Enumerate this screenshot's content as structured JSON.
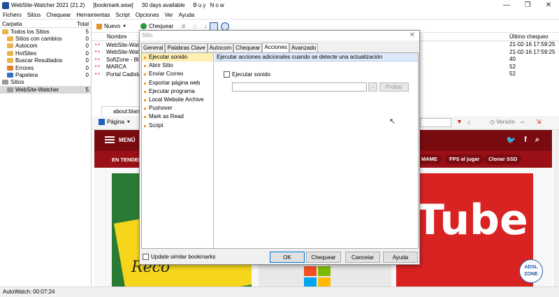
{
  "window": {
    "title": "WebSite-Watcher 2021 (21.2)",
    "file": "[bookmark.wsw]",
    "trial": "30 days available",
    "buy": "Buy Now",
    "controls": [
      "—",
      "❐",
      "✕"
    ]
  },
  "menu": [
    "Fichero",
    "Sitios",
    "Chequear",
    "Herramientas",
    "Script",
    "Opciones",
    "Ver",
    "Ayuda"
  ],
  "folders": {
    "head_folder": "Carpeta",
    "head_total": "Total",
    "items": [
      {
        "label": "Todos los Sitios",
        "count": "5",
        "color": "#e8b64c"
      },
      {
        "label": "Sitios con cambios",
        "count": "0",
        "color": "#e8b64c"
      },
      {
        "label": "Autocom",
        "count": "0",
        "color": "#e8b64c"
      },
      {
        "label": "HotSites",
        "count": "0",
        "color": "#e8b64c"
      },
      {
        "label": "Buscar Resultados",
        "count": "0",
        "color": "#e8b64c"
      },
      {
        "label": "Errores",
        "count": "0",
        "color": "#d9822b"
      },
      {
        "label": "Papelera",
        "count": "0",
        "color": "#2f6fc4"
      },
      {
        "label": "Sitios",
        "count": "",
        "color": "#9a9a9a"
      },
      {
        "label": "WebSite-Watcher",
        "count": "5",
        "color": "#9a9a9a"
      }
    ]
  },
  "toolbar": {
    "new": "Nuevo",
    "check": "Chequear"
  },
  "list": {
    "col_name": "Nombre",
    "col_check": "Último chequeo",
    "rows": [
      "WebSite-Watch",
      "WebSite-Watch",
      "SoftZone - Bl",
      "MARCA",
      "Portal Cadista"
    ],
    "check_values": [
      "21-02-16  17:59:25",
      "21-02-16  17:59:25",
      "40",
      "52",
      "52"
    ]
  },
  "browser": {
    "tab": "about:blank",
    "page_menu": "Página",
    "version": "Versión"
  },
  "site": {
    "menu": "MENÚ",
    "trending": "EN TENDEN",
    "pills": [
      "MAME",
      "FPS al jugar",
      "Clonar SSD"
    ],
    "rec": "Reco",
    "yt": "Tube",
    "badge": "ADSL ZONE"
  },
  "status": "AutoWatch: 00:07:24",
  "dialog": {
    "title": "Sitio",
    "tabs": [
      "General",
      "Palabras Clave",
      "Autocom",
      "Chequear",
      "Acciones",
      "Avanzado"
    ],
    "active_tab": "Acciones",
    "actions": [
      "Ejecutar sonido",
      "Abrir Sitio",
      "Enviar Correo",
      "Exportar página web",
      "Ejecutar programa",
      "Local Website Archive",
      "Pushover",
      "Mark as Read",
      "Script"
    ],
    "header": "Ejecutar acciones adicionales cuando se detecte una actualización",
    "checkbox_label": "Ejecutar sonido",
    "path_value": "",
    "browse": "...",
    "test": "Probar",
    "update_similar": "Update similar bookmarks",
    "ok": "OK",
    "check": "Chequear",
    "cancel": "Cancelar",
    "help": "Ayuda"
  }
}
